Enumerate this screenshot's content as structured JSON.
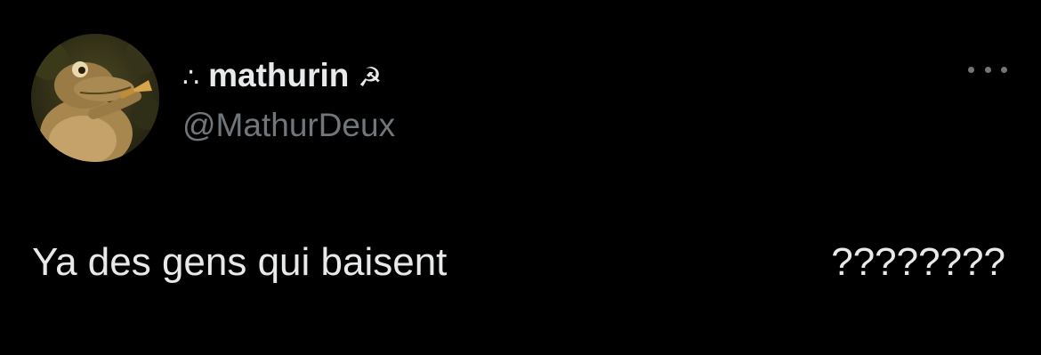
{
  "author": {
    "name_prefix": "∴",
    "display_name": "mathurin",
    "name_suffix": "☭",
    "handle": "@MathurDeux",
    "avatar_icon": "alligator-trumpet-avatar"
  },
  "tweet": {
    "text_left": "Ya des gens qui baisent",
    "text_right": "????????"
  },
  "menu": {
    "icon": "more-horizontal-icon"
  },
  "colors": {
    "background": "#000000",
    "primary_text": "#e7e9ea",
    "secondary_text": "#71767b"
  }
}
